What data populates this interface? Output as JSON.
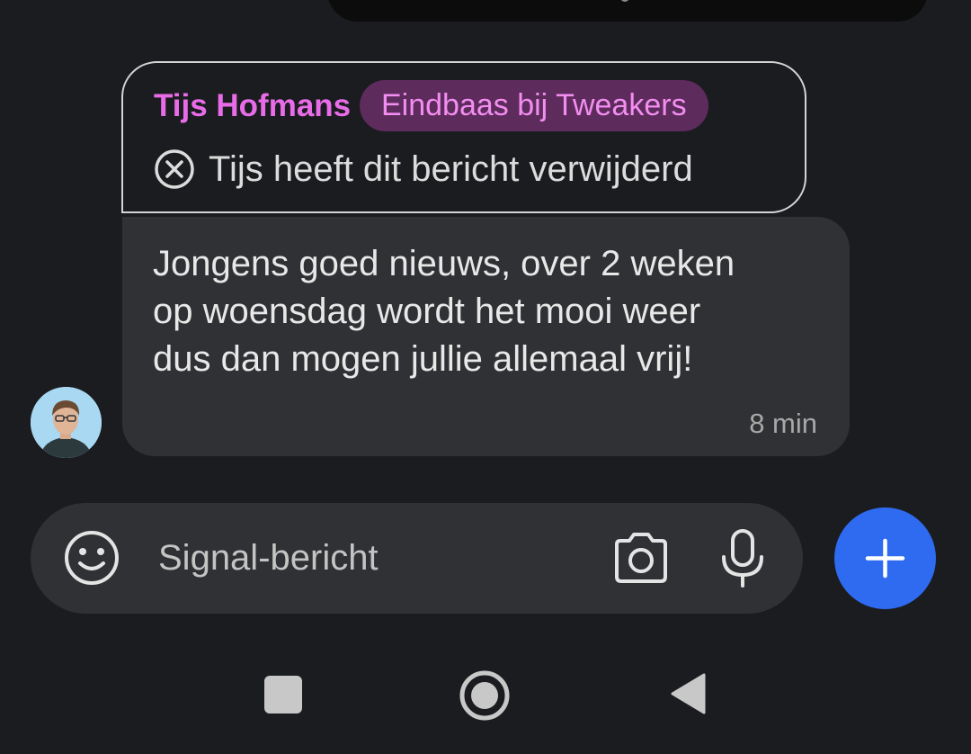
{
  "quoted_message": {
    "author": "Tijs Hofmans",
    "badge": "Eindbaas bij Tweakers",
    "deleted_icon": "deleted-circle-x-icon",
    "deleted_text": "Tijs heeft dit bericht verwijderd"
  },
  "message": {
    "text": "Jongens goed nieuws, over 2 weken\nop woensdag wordt het mooi weer\ndus dan mogen jullie allemaal vrij!",
    "time": "8 min"
  },
  "composer": {
    "placeholder": "Signal-bericht",
    "value": "",
    "emoji_icon": "emoji-icon",
    "camera_icon": "camera-icon",
    "mic_icon": "microphone-icon",
    "add_icon": "plus-icon"
  },
  "colors": {
    "background": "#1b1c1f",
    "bubble": "#303134",
    "author": "#e86ce8",
    "badge_bg": "#5e2b5d",
    "badge_text": "#f28ef0",
    "fab": "#2e6bf0"
  },
  "nav": {
    "recents_icon": "square-recents-icon",
    "home_icon": "circle-home-icon",
    "back_icon": "triangle-back-icon"
  }
}
